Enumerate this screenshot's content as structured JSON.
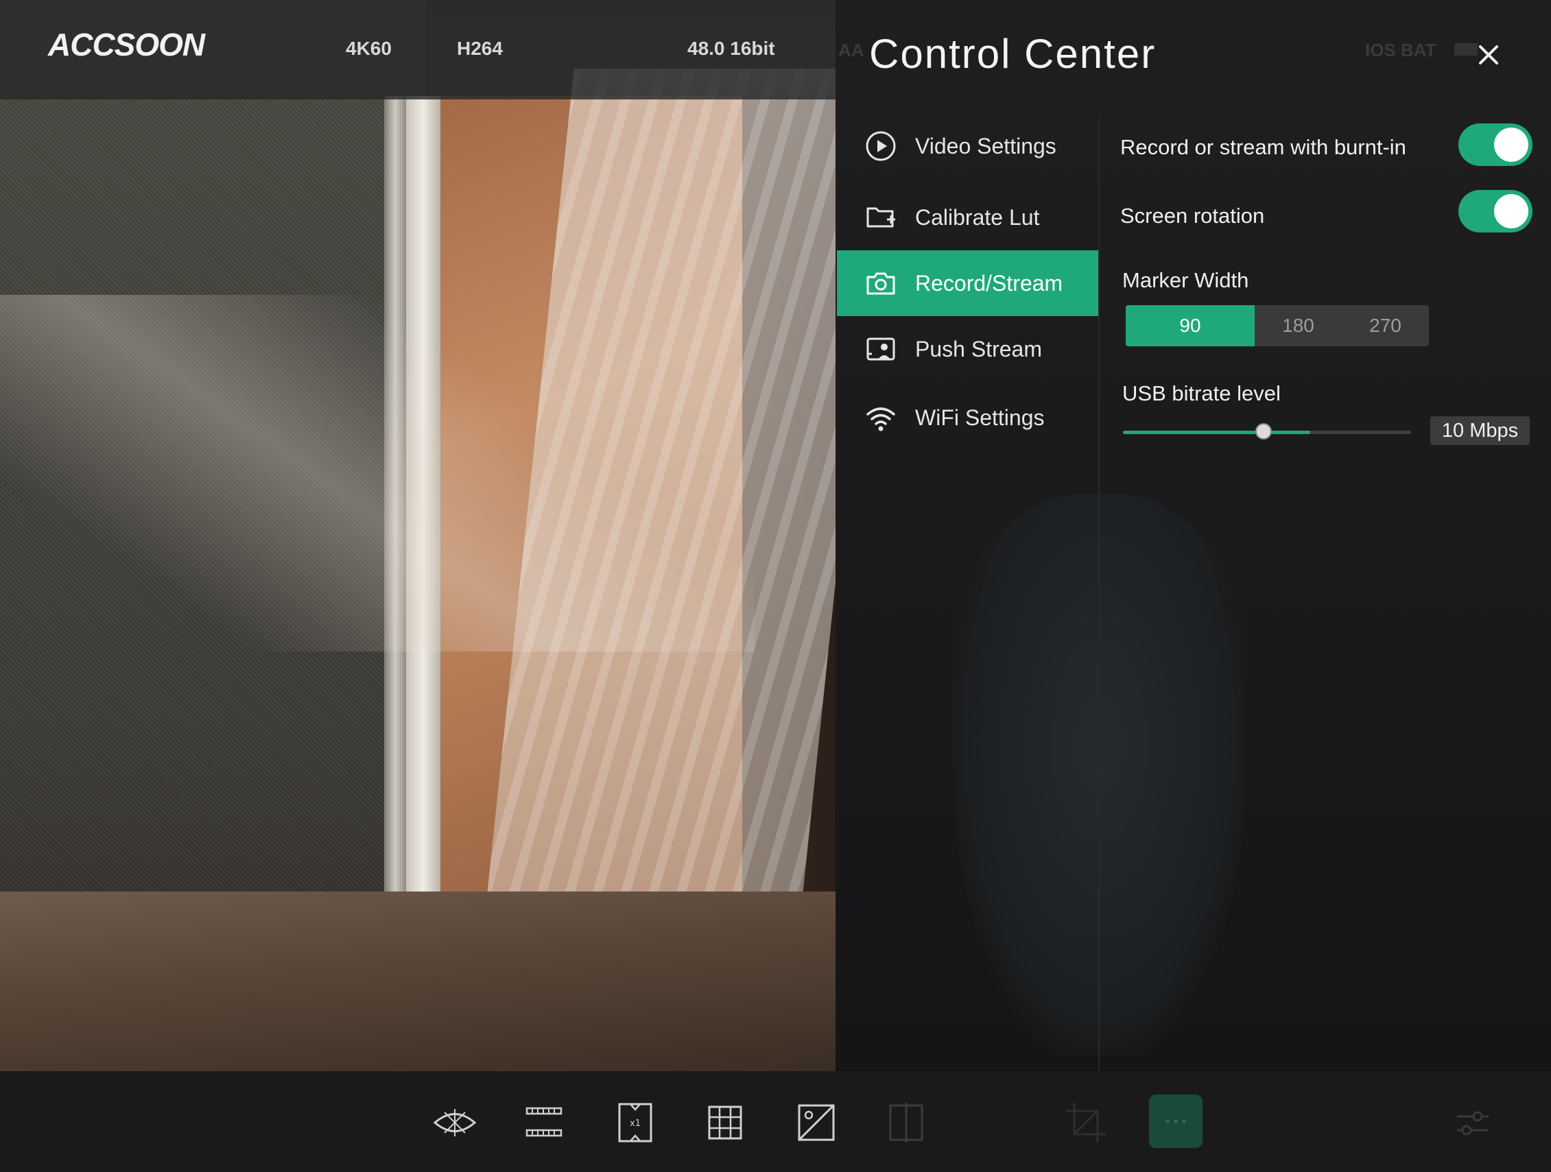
{
  "statusbar": {
    "brand": "ACCSOON",
    "resolution": "4K60",
    "codec": "H264",
    "audio": "48.0 16bit",
    "faded_left": "AA",
    "faded_right": "IOS BAT"
  },
  "control_center": {
    "title": "Control Center",
    "menu": [
      {
        "label": "Video Settings",
        "icon": "play-circle-icon"
      },
      {
        "label": "Calibrate Lut",
        "icon": "folder-plus-icon"
      },
      {
        "label": "Record/Stream",
        "icon": "camera-icon",
        "active": true
      },
      {
        "label": "Push Stream",
        "icon": "stream-person-icon"
      },
      {
        "label": "WiFi Settings",
        "icon": "wifi-icon"
      }
    ],
    "settings": {
      "burnt_in_label": "Record or stream with burnt-in",
      "burnt_in_on": true,
      "screen_rotation_label": "Screen rotation",
      "screen_rotation_on": true,
      "marker_width_label": "Marker Width",
      "marker_width_options": [
        "90",
        "180",
        "270"
      ],
      "marker_width_selected": "90",
      "usb_bitrate_label": "USB bitrate level",
      "usb_bitrate_value": "10 Mbps",
      "usb_bitrate_level": 0.46
    }
  },
  "toolbar": {
    "icons": [
      "focus-peaking-icon",
      "zebra-lines-icon",
      "anamorphic-desqueeze-icon",
      "grid-icon",
      "false-color-icon",
      "compare-split-icon",
      "crop-icon",
      "more-icon",
      "adjust-sliders-icon"
    ]
  },
  "colors": {
    "accent": "#1fa97b",
    "panel_bg": "#1c1c1d"
  }
}
